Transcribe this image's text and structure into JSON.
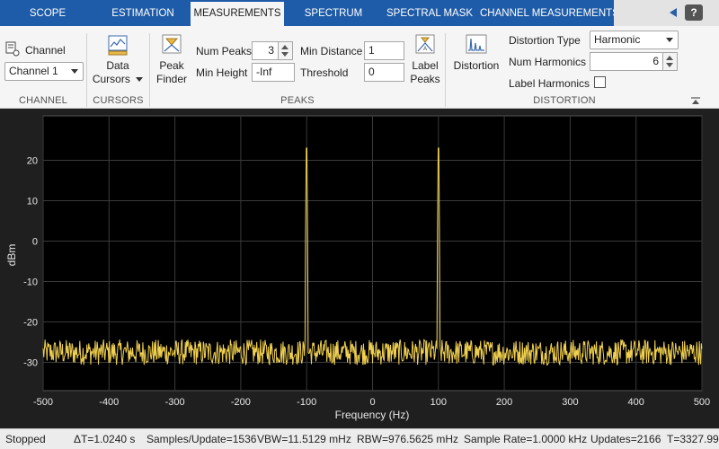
{
  "tabs": [
    {
      "label": "SCOPE",
      "active": false
    },
    {
      "label": "ESTIMATION",
      "active": false
    },
    {
      "label": "MEASUREMENTS",
      "active": true
    },
    {
      "label": "SPECTRUM",
      "active": false
    },
    {
      "label": "SPECTRAL MASK",
      "active": false
    },
    {
      "label": "CHANNEL MEASUREMENTS",
      "active": false
    }
  ],
  "help_label": "?",
  "toolstrip": {
    "channel": {
      "label": "Channel",
      "selected": "Channel 1",
      "section_title": "CHANNEL"
    },
    "cursors": {
      "button_label_line1": "Data",
      "button_label_line2": "Cursors",
      "section_title": "CURSORS"
    },
    "peaks": {
      "peak_finder_line1": "Peak",
      "peak_finder_line2": "Finder",
      "num_peaks_label": "Num Peaks",
      "num_peaks_value": "3",
      "min_height_label": "Min Height",
      "min_height_value": "-Inf",
      "min_distance_label": "Min Distance",
      "min_distance_value": "1",
      "threshold_label": "Threshold",
      "threshold_value": "0",
      "label_peaks_line1": "Label",
      "label_peaks_line2": "Peaks",
      "section_title": "PEAKS"
    },
    "distortion": {
      "button_label": "Distortion",
      "type_label": "Distortion Type",
      "type_value": "Harmonic",
      "num_harmonics_label": "Num Harmonics",
      "num_harmonics_value": "6",
      "label_harmonics_label": "Label Harmonics",
      "label_harmonics_checked": false,
      "section_title": "DISTORTION"
    }
  },
  "chart_data": {
    "type": "line",
    "xlabel": "Frequency (Hz)",
    "ylabel": "dBm",
    "xlim": [
      -500,
      500
    ],
    "ylim": [
      -37,
      31
    ],
    "xticks": [
      -500,
      -400,
      -300,
      -200,
      -100,
      0,
      100,
      200,
      300,
      400,
      500
    ],
    "yticks": [
      20,
      10,
      0,
      -10,
      -20,
      -30
    ],
    "grid": true,
    "series": [
      {
        "noise_floor_dbm": -27.5,
        "noise_span_dbm": [
          -31,
          -24
        ],
        "peaks": [
          {
            "x": -100,
            "y": 23
          },
          {
            "x": 100,
            "y": 23
          }
        ],
        "color": "#f0d050"
      }
    ],
    "background": "#000000",
    "grid_color": "#3a3a3a"
  },
  "status": {
    "state": "Stopped",
    "delta_t": "ΔT=1.0240 s",
    "samples_per_update": "Samples/Update=1536",
    "vbw": "VBW=11.5129 mHz",
    "rbw": "RBW=976.5625 mHz",
    "sample_rate": "Sample Rate=1.0000 kHz",
    "updates": "Updates=2166",
    "time": "T=3327.99"
  }
}
